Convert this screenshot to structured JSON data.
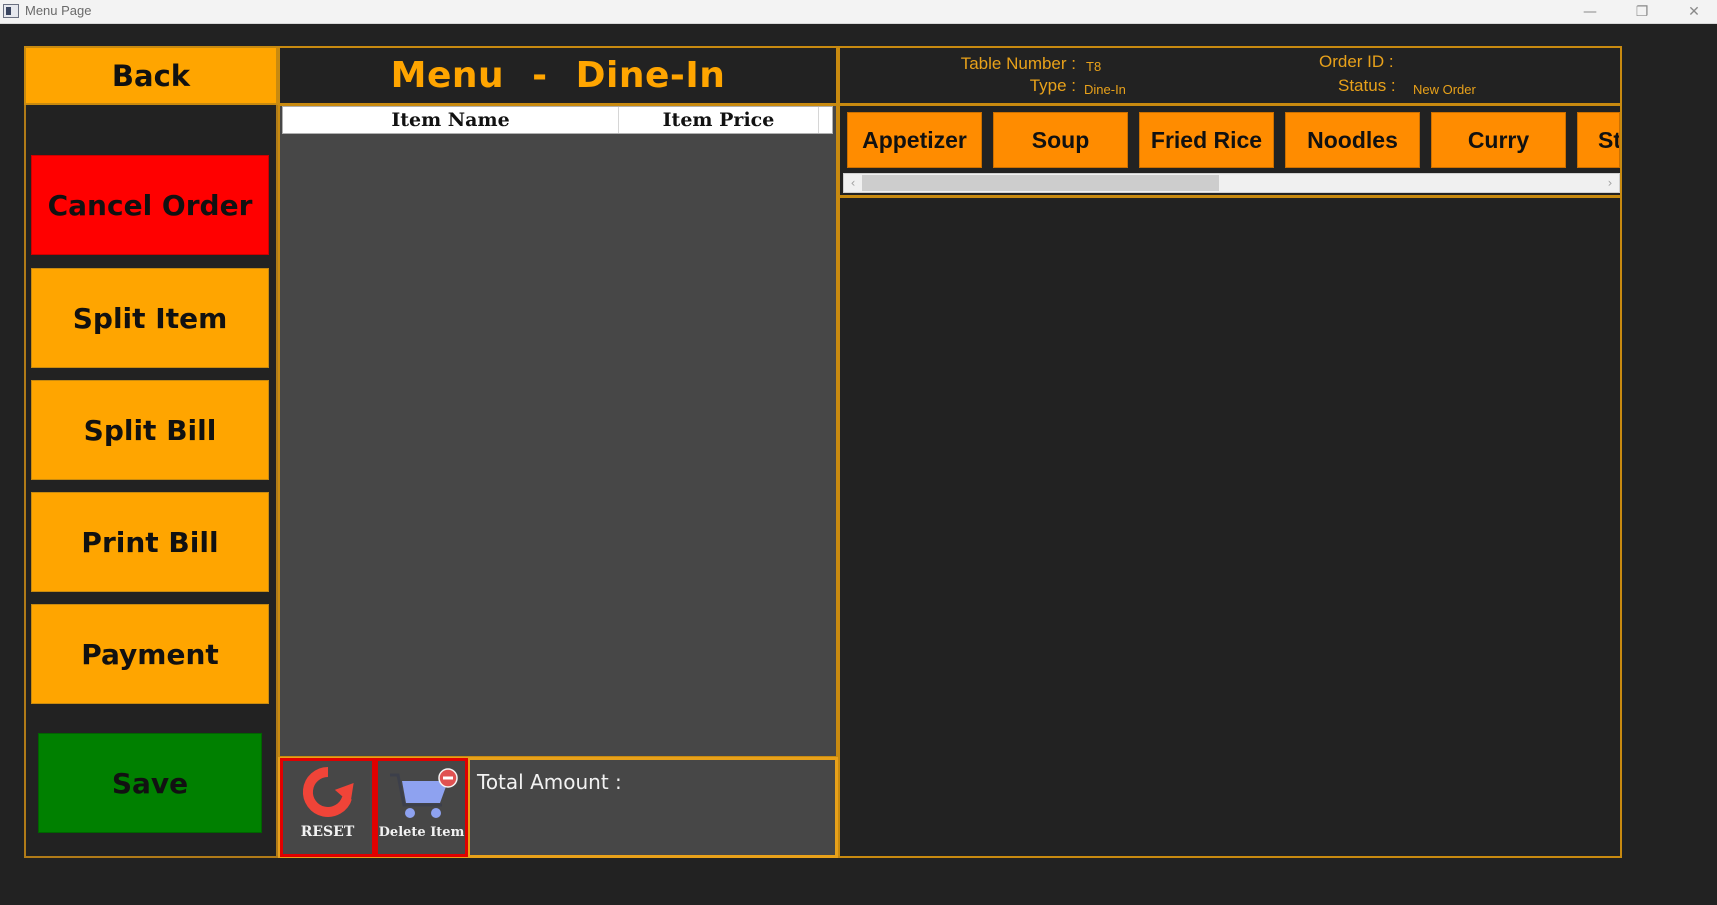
{
  "window": {
    "title": "Menu Page",
    "controls": {
      "minimize": "—",
      "restore": "❐",
      "close": "✕"
    }
  },
  "sidebar": {
    "back_label": "Back",
    "buttons": [
      {
        "label": "Cancel Order",
        "color": "#ff0000"
      },
      {
        "label": "Split Item",
        "color": "#ffa500"
      },
      {
        "label": "Split Bill",
        "color": "#ffa500"
      },
      {
        "label": "Print Bill",
        "color": "#ffa500"
      },
      {
        "label": "Payment",
        "color": "#ffa500"
      },
      {
        "label": "Save",
        "color": "#008000"
      }
    ]
  },
  "order_panel": {
    "title_left": "Menu",
    "title_sep": "-",
    "title_right": "Dine-In",
    "columns": [
      "Item Name",
      "Item Price"
    ],
    "items": [],
    "reset_label": "RESET",
    "delete_label": "Delete Item",
    "total_label": "Total Amount :",
    "total_value": ""
  },
  "order_info": {
    "table_number_label": "Table Number :",
    "table_number": "T8",
    "type_label": "Type :",
    "type": "Dine-In",
    "order_id_label": "Order ID :",
    "order_id": "",
    "status_label": "Status :",
    "status": "New Order"
  },
  "categories": {
    "items": [
      "Appetizer",
      "Soup",
      "Fried Rice",
      "Noodles",
      "Curry",
      "St"
    ],
    "scroll_left": "‹",
    "scroll_right": "›"
  },
  "colors": {
    "accent_orange": "#ffa500",
    "category_orange": "#ff8c00",
    "border_gold": "#e8a11a",
    "danger_red": "#ff0000",
    "save_green": "#008000",
    "background": "#222222",
    "list_bg": "#474747"
  }
}
